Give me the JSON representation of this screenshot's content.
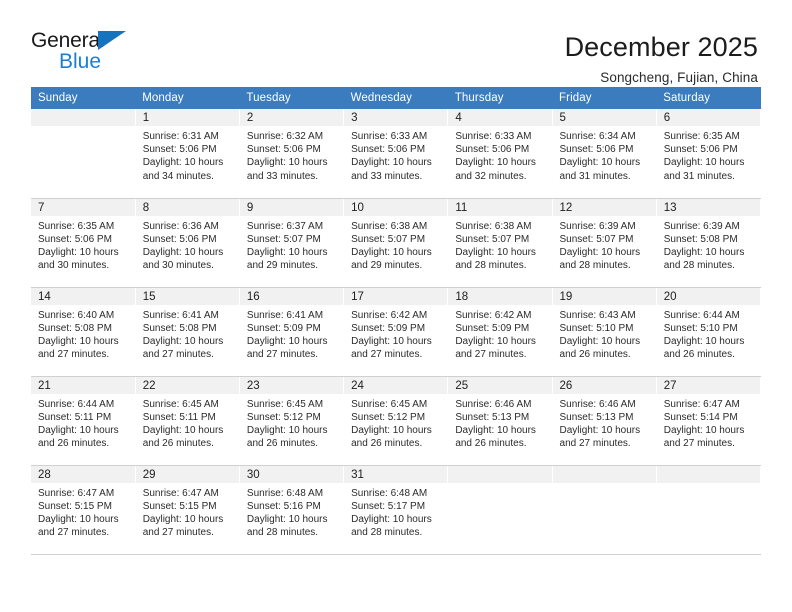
{
  "brand": {
    "name_part1": "General",
    "name_part2": "Blue",
    "accent_color": "#1b7fd0"
  },
  "header": {
    "month_title": "December 2025",
    "location": "Songcheng, Fujian, China"
  },
  "calendar": {
    "header_color": "#3a7cbd",
    "weekday_headers": [
      "Sunday",
      "Monday",
      "Tuesday",
      "Wednesday",
      "Thursday",
      "Friday",
      "Saturday"
    ],
    "weeks": [
      [
        {
          "day": "",
          "sunrise": "",
          "sunset": "",
          "daylight": ""
        },
        {
          "day": "1",
          "sunrise": "Sunrise: 6:31 AM",
          "sunset": "Sunset: 5:06 PM",
          "daylight": "Daylight: 10 hours and 34 minutes."
        },
        {
          "day": "2",
          "sunrise": "Sunrise: 6:32 AM",
          "sunset": "Sunset: 5:06 PM",
          "daylight": "Daylight: 10 hours and 33 minutes."
        },
        {
          "day": "3",
          "sunrise": "Sunrise: 6:33 AM",
          "sunset": "Sunset: 5:06 PM",
          "daylight": "Daylight: 10 hours and 33 minutes."
        },
        {
          "day": "4",
          "sunrise": "Sunrise: 6:33 AM",
          "sunset": "Sunset: 5:06 PM",
          "daylight": "Daylight: 10 hours and 32 minutes."
        },
        {
          "day": "5",
          "sunrise": "Sunrise: 6:34 AM",
          "sunset": "Sunset: 5:06 PM",
          "daylight": "Daylight: 10 hours and 31 minutes."
        },
        {
          "day": "6",
          "sunrise": "Sunrise: 6:35 AM",
          "sunset": "Sunset: 5:06 PM",
          "daylight": "Daylight: 10 hours and 31 minutes."
        }
      ],
      [
        {
          "day": "7",
          "sunrise": "Sunrise: 6:35 AM",
          "sunset": "Sunset: 5:06 PM",
          "daylight": "Daylight: 10 hours and 30 minutes."
        },
        {
          "day": "8",
          "sunrise": "Sunrise: 6:36 AM",
          "sunset": "Sunset: 5:06 PM",
          "daylight": "Daylight: 10 hours and 30 minutes."
        },
        {
          "day": "9",
          "sunrise": "Sunrise: 6:37 AM",
          "sunset": "Sunset: 5:07 PM",
          "daylight": "Daylight: 10 hours and 29 minutes."
        },
        {
          "day": "10",
          "sunrise": "Sunrise: 6:38 AM",
          "sunset": "Sunset: 5:07 PM",
          "daylight": "Daylight: 10 hours and 29 minutes."
        },
        {
          "day": "11",
          "sunrise": "Sunrise: 6:38 AM",
          "sunset": "Sunset: 5:07 PM",
          "daylight": "Daylight: 10 hours and 28 minutes."
        },
        {
          "day": "12",
          "sunrise": "Sunrise: 6:39 AM",
          "sunset": "Sunset: 5:07 PM",
          "daylight": "Daylight: 10 hours and 28 minutes."
        },
        {
          "day": "13",
          "sunrise": "Sunrise: 6:39 AM",
          "sunset": "Sunset: 5:08 PM",
          "daylight": "Daylight: 10 hours and 28 minutes."
        }
      ],
      [
        {
          "day": "14",
          "sunrise": "Sunrise: 6:40 AM",
          "sunset": "Sunset: 5:08 PM",
          "daylight": "Daylight: 10 hours and 27 minutes."
        },
        {
          "day": "15",
          "sunrise": "Sunrise: 6:41 AM",
          "sunset": "Sunset: 5:08 PM",
          "daylight": "Daylight: 10 hours and 27 minutes."
        },
        {
          "day": "16",
          "sunrise": "Sunrise: 6:41 AM",
          "sunset": "Sunset: 5:09 PM",
          "daylight": "Daylight: 10 hours and 27 minutes."
        },
        {
          "day": "17",
          "sunrise": "Sunrise: 6:42 AM",
          "sunset": "Sunset: 5:09 PM",
          "daylight": "Daylight: 10 hours and 27 minutes."
        },
        {
          "day": "18",
          "sunrise": "Sunrise: 6:42 AM",
          "sunset": "Sunset: 5:09 PM",
          "daylight": "Daylight: 10 hours and 27 minutes."
        },
        {
          "day": "19",
          "sunrise": "Sunrise: 6:43 AM",
          "sunset": "Sunset: 5:10 PM",
          "daylight": "Daylight: 10 hours and 26 minutes."
        },
        {
          "day": "20",
          "sunrise": "Sunrise: 6:44 AM",
          "sunset": "Sunset: 5:10 PM",
          "daylight": "Daylight: 10 hours and 26 minutes."
        }
      ],
      [
        {
          "day": "21",
          "sunrise": "Sunrise: 6:44 AM",
          "sunset": "Sunset: 5:11 PM",
          "daylight": "Daylight: 10 hours and 26 minutes."
        },
        {
          "day": "22",
          "sunrise": "Sunrise: 6:45 AM",
          "sunset": "Sunset: 5:11 PM",
          "daylight": "Daylight: 10 hours and 26 minutes."
        },
        {
          "day": "23",
          "sunrise": "Sunrise: 6:45 AM",
          "sunset": "Sunset: 5:12 PM",
          "daylight": "Daylight: 10 hours and 26 minutes."
        },
        {
          "day": "24",
          "sunrise": "Sunrise: 6:45 AM",
          "sunset": "Sunset: 5:12 PM",
          "daylight": "Daylight: 10 hours and 26 minutes."
        },
        {
          "day": "25",
          "sunrise": "Sunrise: 6:46 AM",
          "sunset": "Sunset: 5:13 PM",
          "daylight": "Daylight: 10 hours and 26 minutes."
        },
        {
          "day": "26",
          "sunrise": "Sunrise: 6:46 AM",
          "sunset": "Sunset: 5:13 PM",
          "daylight": "Daylight: 10 hours and 27 minutes."
        },
        {
          "day": "27",
          "sunrise": "Sunrise: 6:47 AM",
          "sunset": "Sunset: 5:14 PM",
          "daylight": "Daylight: 10 hours and 27 minutes."
        }
      ],
      [
        {
          "day": "28",
          "sunrise": "Sunrise: 6:47 AM",
          "sunset": "Sunset: 5:15 PM",
          "daylight": "Daylight: 10 hours and 27 minutes."
        },
        {
          "day": "29",
          "sunrise": "Sunrise: 6:47 AM",
          "sunset": "Sunset: 5:15 PM",
          "daylight": "Daylight: 10 hours and 27 minutes."
        },
        {
          "day": "30",
          "sunrise": "Sunrise: 6:48 AM",
          "sunset": "Sunset: 5:16 PM",
          "daylight": "Daylight: 10 hours and 28 minutes."
        },
        {
          "day": "31",
          "sunrise": "Sunrise: 6:48 AM",
          "sunset": "Sunset: 5:17 PM",
          "daylight": "Daylight: 10 hours and 28 minutes."
        },
        {
          "day": "",
          "sunrise": "",
          "sunset": "",
          "daylight": ""
        },
        {
          "day": "",
          "sunrise": "",
          "sunset": "",
          "daylight": ""
        },
        {
          "day": "",
          "sunrise": "",
          "sunset": "",
          "daylight": ""
        }
      ]
    ]
  }
}
